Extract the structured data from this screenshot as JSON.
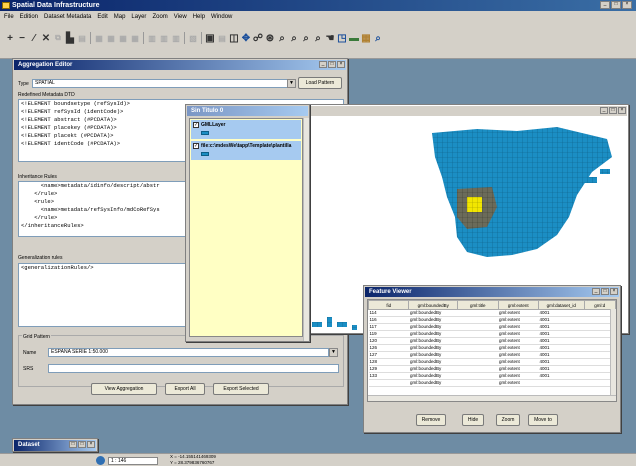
{
  "app": {
    "title": "Spatial Data Infrastructure",
    "menu": [
      "File",
      "Edition",
      "Dataset Metadata",
      "Edit",
      "Map",
      "Layer",
      "Zoom",
      "View",
      "Help",
      "Window"
    ],
    "window_controls": [
      "_",
      "□",
      "×"
    ]
  },
  "toolbar": {
    "icons": [
      "add-icon",
      "remove-icon",
      "pencil-icon",
      "delete-icon",
      "copy-icon",
      "paste-icon",
      "table-icon",
      "grid-icon",
      "grid2-icon",
      "grid3-icon",
      "grid4-icon",
      "grid5-icon",
      "grid6-icon",
      "layers-icon",
      "save-icon",
      "open-icon",
      "move-icon",
      "pointer-icon",
      "globe-icon",
      "zoom-in-icon",
      "zoom-out-icon",
      "zoom-extent-icon",
      "zoom-prev-icon",
      "pan-icon",
      "info-icon",
      "select-icon",
      "measure-icon",
      "search-icon"
    ]
  },
  "aggregation_editor": {
    "title": "Aggregation Editor",
    "type_label": "Type",
    "type_value": "SPATIAL",
    "load_pattern": "Load Pattern",
    "redefined_label": "Redefined Metadata DTD",
    "redefined_code": "<!ELEMENT boundsetype (refSysId)>\n<!ELEMENT refSysId (identCode)>\n<!ELEMENT abstract (#PCDATA)>\n<!ELEMENT placekey (#PCDATA)>\n<!ELEMENT placekt (#PCDATA)>\n<!ELEMENT identCode (#PCDATA)>",
    "inheritance_label": "Inheritance Rules",
    "inheritance_code": "      <name>metadata/idinfo/descript/abstr\n    </rule>\n    <rule>\n      <name>metadata/refSysInfo/mdCoRefSys\n    </rule>\n</inheritanceRules>",
    "generalization_label": "Generalization rules",
    "generalization_code": "<generalizationRules/>",
    "grid_pattern_label": "Grid Pattern",
    "name_label": "Name",
    "name_value": "ESPAÑA SERIE 1:50.000",
    "srs_label": "SRS",
    "srs_value": "",
    "view_aggregation": "View Aggregation",
    "export_all": "Export All",
    "export_selected": "Export Selected"
  },
  "layer_window": {
    "title": "Sin Titulo 0",
    "layers": [
      {
        "name": "GMLLayer",
        "checked": true
      },
      {
        "name": "file:c:\\mdesWe\\tapp\\Template\\plantilla",
        "checked": true
      }
    ]
  },
  "map": {
    "land_color": "#1b8ec4",
    "highlight_dark": "#6b6b5a",
    "highlight_yellow": "#f2e600"
  },
  "feature_viewer": {
    "title": "Feature Viewer",
    "columns": [
      "fid",
      "gml:boundedBy",
      "gml:title",
      "gml:extent",
      "gml:dataset_id",
      "gml:d"
    ],
    "rows": [
      [
        "114",
        "gml:boundedBy",
        "",
        "gml:extent",
        "4001",
        ""
      ],
      [
        "116",
        "gml:boundedBy",
        "",
        "gml:extent",
        "4001",
        ""
      ],
      [
        "117",
        "gml:boundedBy",
        "",
        "gml:extent",
        "4001",
        ""
      ],
      [
        "119",
        "gml:boundedBy",
        "",
        "gml:extent",
        "4001",
        ""
      ],
      [
        "120",
        "gml:boundedBy",
        "",
        "gml:extent",
        "4001",
        ""
      ],
      [
        "126",
        "gml:boundedBy",
        "",
        "gml:extent",
        "4001",
        ""
      ],
      [
        "127",
        "gml:boundedBy",
        "",
        "gml:extent",
        "4001",
        ""
      ],
      [
        "128",
        "gml:boundedBy",
        "",
        "gml:extent",
        "4001",
        ""
      ],
      [
        "129",
        "gml:boundedBy",
        "",
        "gml:extent",
        "4001",
        ""
      ],
      [
        "133",
        "gml:boundedBy",
        "",
        "gml:extent",
        "4001",
        ""
      ],
      [
        "",
        "gml:boundedBy",
        "",
        "gml:extent",
        "",
        ""
      ]
    ],
    "remove": "Remove",
    "hide": "Hide",
    "zoom": "Zoom",
    "move_to": "Move to"
  },
  "dataset_window": {
    "title": "Dataset"
  },
  "status": {
    "scale": "1 : 146",
    "coord_x": "X = -14.155141469309",
    "coord_y": "Y = 28.379836760767"
  }
}
